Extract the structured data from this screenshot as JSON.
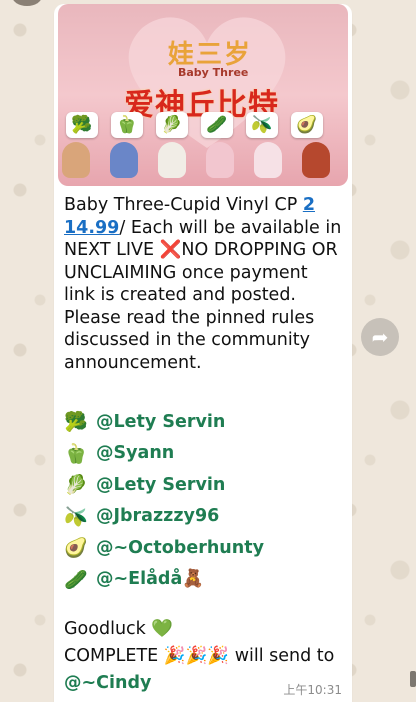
{
  "image": {
    "title_cn": "娃三岁",
    "title_en": "Baby Three",
    "title_big": "爱神丘比特",
    "emoji_row": [
      "🥦",
      "🫑",
      "🥬",
      "🥒",
      "🫒",
      "🥑"
    ]
  },
  "message": {
    "line_prefix": "Baby Three-Cupid Vinyl  CP ",
    "price": "2 14.99",
    "line_rest": "/ Each will be available in NEXT LIVE ",
    "x_mark": "❌",
    "line_end": "NO DROPPING OR UNCLAIMING once payment link is created and posted. Please read the pinned rules discussed in the community announcement.",
    "mentions": [
      {
        "emoji": "🥦",
        "name": "@Lety Servin"
      },
      {
        "emoji": "🫑",
        "name": "@Syann"
      },
      {
        "emoji": "🥬",
        "name": "@Lety Servin"
      },
      {
        "emoji": "🫒",
        "name": "@Jbrazzzy96"
      },
      {
        "emoji": "🥑",
        "name": "@~Octoberhunty"
      },
      {
        "emoji": "🥒",
        "name": "@~Elådå🧸"
      }
    ],
    "goodluck": "Goodluck ",
    "green_heart": "💚",
    "complete_prefix": "COMPLETE ",
    "party": "🎉🎉🎉",
    "complete_suffix": " will send to ",
    "cindy": "@~Cindy",
    "timestamp": "上午10:31"
  },
  "colors": {
    "mention": "#1f7d52",
    "link": "#1a6fc4",
    "bubble": "#ffffff",
    "background": "#efe7dc"
  }
}
